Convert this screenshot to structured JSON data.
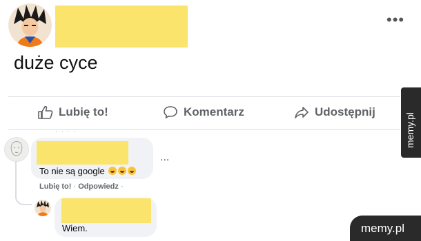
{
  "post": {
    "text": "duże cyce",
    "more_label": "•••"
  },
  "actions": {
    "like_label": "Lubię to!",
    "comment_label": "Komentarz",
    "share_label": "Udostępnij"
  },
  "comments": [
    {
      "text": "To nie są google",
      "more_label": "...",
      "like_label": "Lubię to!",
      "separator": "·",
      "reply_label": "Odpowiedz",
      "trailing": "·"
    },
    {
      "text": "Wiem."
    }
  ],
  "watermark": {
    "side_text": "memy.pl",
    "corner_text": "memy.pl"
  },
  "colors": {
    "redaction": "#fbe46b",
    "action_text": "#5f6366",
    "bubble": "#f0f2f5",
    "watermark_bg": "#2a2a2a"
  }
}
